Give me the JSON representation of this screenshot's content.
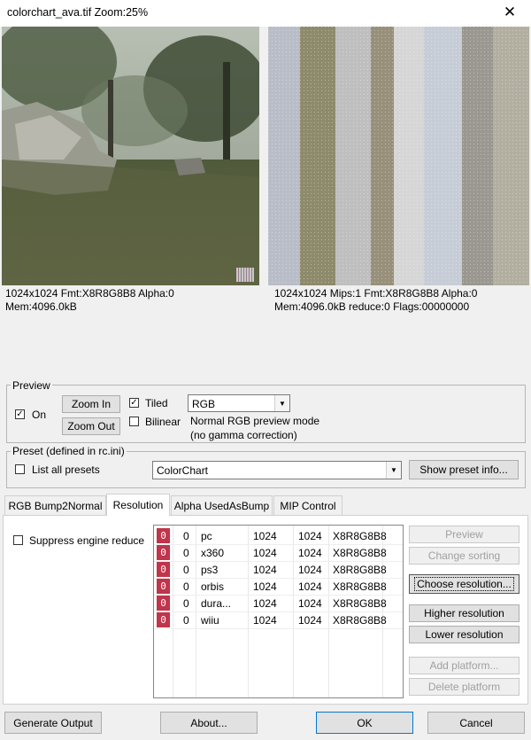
{
  "window": {
    "title": "colorchart_ava.tif  Zoom:25%",
    "close_icon": "close-icon"
  },
  "left_preview": {
    "info_line1": "1024x1024 Fmt:X8R8G8B8 Alpha:0",
    "info_line2": "Mem:4096.0kB"
  },
  "right_preview": {
    "info_line1": "1024x1024 Mips:1 Fmt:X8R8G8B8 Alpha:0",
    "info_line2": "Mem:4096.0kB reduce:0 Flags:00000000"
  },
  "preview_group": {
    "title": "Preview",
    "on_label": "On",
    "on_checked": true,
    "zoom_in": "Zoom In",
    "zoom_out": "Zoom Out",
    "tiled_label": "Tiled",
    "tiled_checked": true,
    "bilinear_label": "Bilinear",
    "bilinear_checked": false,
    "mode_value": "RGB",
    "mode_desc1": "Normal RGB preview mode",
    "mode_desc2": "(no gamma correction)"
  },
  "preset_group": {
    "title": "Preset (defined in rc.ini)",
    "list_all_label": "List all presets",
    "preset_value": "ColorChart",
    "show_info_button": "Show preset info..."
  },
  "tabs": [
    {
      "label": "RGB Bump2Normal",
      "active": false
    },
    {
      "label": "Resolution",
      "active": true
    },
    {
      "label": "Alpha UsedAsBump",
      "active": false
    },
    {
      "label": "MIP Control",
      "active": false
    }
  ],
  "resolution": {
    "suppress_label": "Suppress engine reduce",
    "rows": [
      {
        "icon": "0",
        "reduce": "0",
        "platform": "pc",
        "width": "1024",
        "height": "1024",
        "format": "X8R8G8B8"
      },
      {
        "icon": "0",
        "reduce": "0",
        "platform": "x360",
        "width": "1024",
        "height": "1024",
        "format": "X8R8G8B8"
      },
      {
        "icon": "0",
        "reduce": "0",
        "platform": "ps3",
        "width": "1024",
        "height": "1024",
        "format": "X8R8G8B8"
      },
      {
        "icon": "0",
        "reduce": "0",
        "platform": "orbis",
        "width": "1024",
        "height": "1024",
        "format": "X8R8G8B8"
      },
      {
        "icon": "0",
        "reduce": "0",
        "platform": "dura...",
        "width": "1024",
        "height": "1024",
        "format": "X8R8G8B8"
      },
      {
        "icon": "0",
        "reduce": "0",
        "platform": "wiiu",
        "width": "1024",
        "height": "1024",
        "format": "X8R8G8B8"
      }
    ],
    "buttons": {
      "preview": "Preview",
      "change_sorting": "Change sorting",
      "choose_resolution": "Choose resolution...",
      "higher": "Higher resolution",
      "lower": "Lower resolution",
      "add_platform": "Add platform...",
      "delete_platform": "Delete platform"
    }
  },
  "bottom": {
    "generate": "Generate Output",
    "about": "About...",
    "ok": "OK",
    "cancel": "Cancel"
  },
  "colors": {
    "row_icon": "#c0344c",
    "window_bg": "#f0f0f0"
  }
}
